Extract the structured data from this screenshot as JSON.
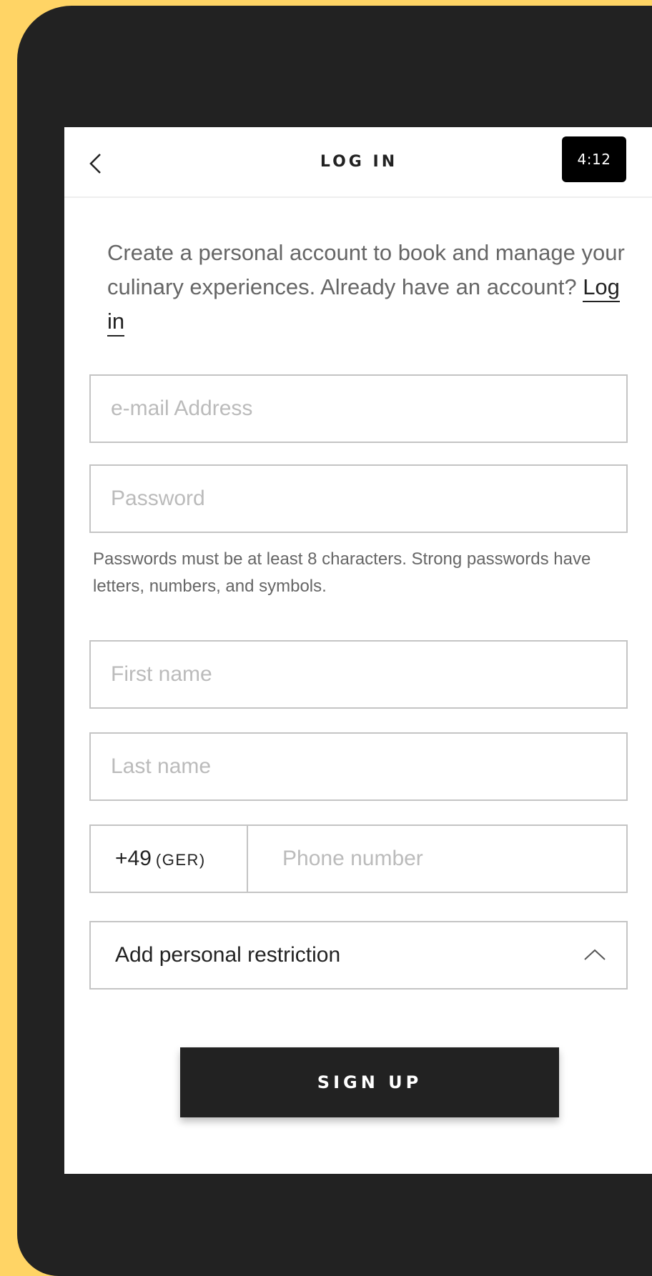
{
  "header": {
    "title": "LOG IN",
    "time": "4:12",
    "back_icon": "chevron-left-icon"
  },
  "intro": {
    "text": "Create a personal account to book and manage your culinary experiences. Already have an account? ",
    "login_link": "Log in"
  },
  "form": {
    "email_placeholder": "e-mail Address",
    "email_value": "",
    "password_placeholder": "Password",
    "password_value": "",
    "password_hint": "Passwords must be at least 8 characters. Strong passwords have letters, numbers, and symbols.",
    "first_name_placeholder": "First name",
    "first_name_value": "",
    "last_name_placeholder": "Last name",
    "last_name_value": "",
    "country_code": "+49",
    "country_region": "(GER)",
    "phone_placeholder": "Phone number",
    "phone_value": "",
    "restriction_label": "Add personal restriction",
    "restriction_icon": "chevron-up-icon"
  },
  "actions": {
    "signup_label": "SIGN UP"
  },
  "colors": {
    "background": "#FFD465",
    "device": "#222222",
    "button": "#222222",
    "field_border": "#C4C4C4"
  }
}
